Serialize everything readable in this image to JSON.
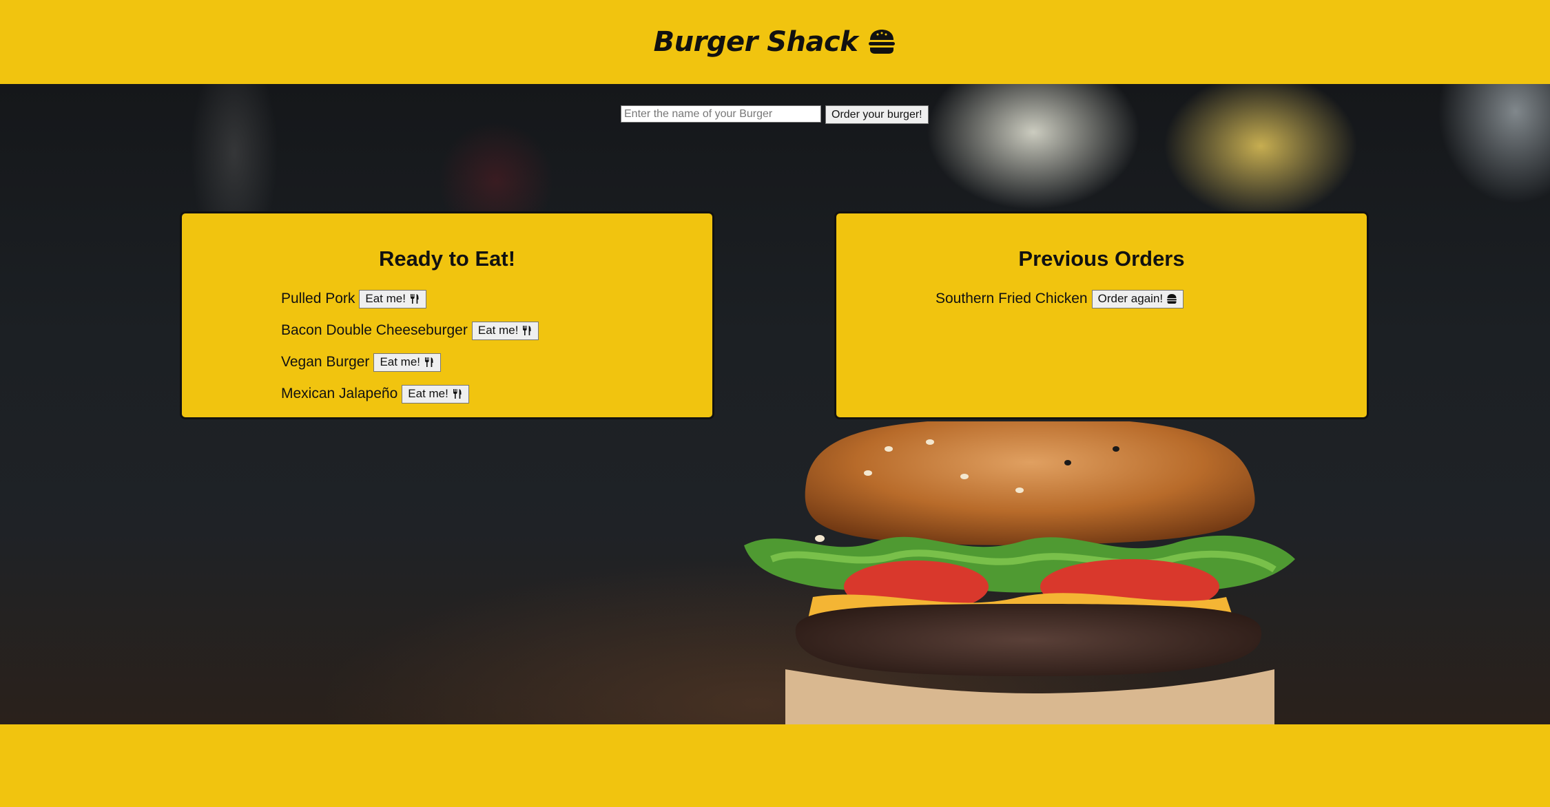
{
  "header": {
    "title": "Burger Shack",
    "title_icon": "burger-icon"
  },
  "order_form": {
    "placeholder": "Enter the name of your Burger",
    "value": "",
    "submit_label": "Order your burger!"
  },
  "ready": {
    "heading": "Ready to Eat!",
    "items": [
      {
        "name": "Pulled Pork",
        "button": "Eat me!",
        "icon": "utensils-icon"
      },
      {
        "name": "Bacon Double Cheeseburger",
        "button": "Eat me!",
        "icon": "utensils-icon"
      },
      {
        "name": "Vegan Burger",
        "button": "Eat me!",
        "icon": "utensils-icon"
      },
      {
        "name": "Mexican Jalapeño",
        "button": "Eat me!",
        "icon": "utensils-icon"
      }
    ]
  },
  "previous": {
    "heading": "Previous Orders",
    "items": [
      {
        "name": "Southern Fried Chicken",
        "button": "Order again!",
        "icon": "burger-icon"
      }
    ]
  },
  "colors": {
    "brand_yellow": "#f1c40f",
    "text": "#111111"
  }
}
